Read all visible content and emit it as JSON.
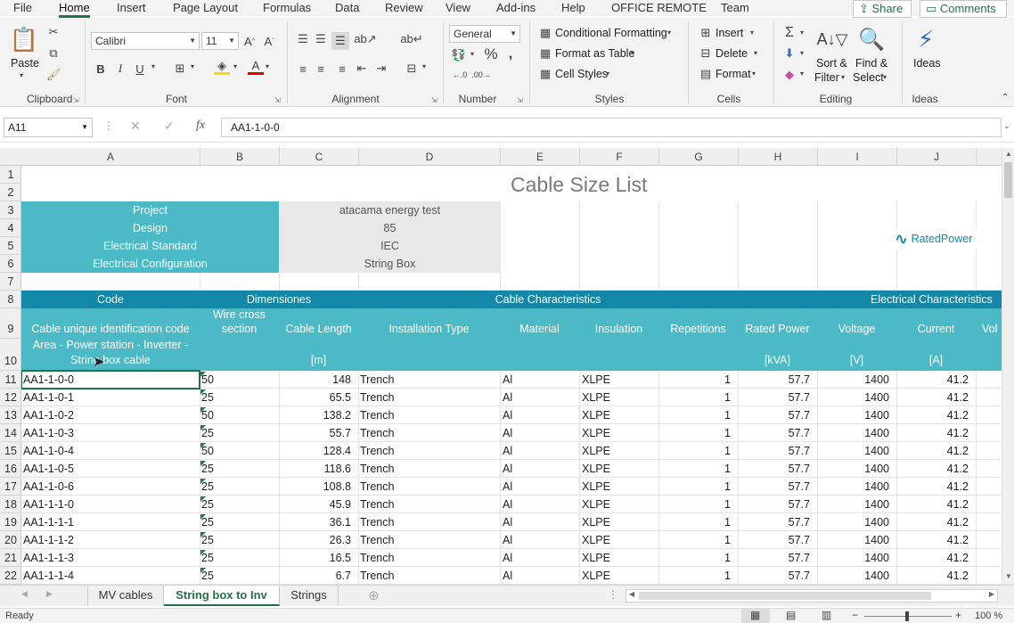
{
  "menu": {
    "tabs": [
      "File",
      "Home",
      "Insert",
      "Page Layout",
      "Formulas",
      "Data",
      "Review",
      "View",
      "Add-ins",
      "Help",
      "OFFICE REMOTE",
      "Team"
    ],
    "active": "Home",
    "share_label": "Share",
    "comments_label": "Comments"
  },
  "ribbon": {
    "clipboard": {
      "label": "Clipboard",
      "paste": "Paste"
    },
    "font": {
      "label": "Font",
      "name": "Calibri",
      "size": "11"
    },
    "alignment": {
      "label": "Alignment"
    },
    "number": {
      "label": "Number",
      "format": "General"
    },
    "styles": {
      "label": "Styles",
      "conditional": "Conditional Formatting",
      "format_table": "Format as Table",
      "cell_styles": "Cell Styles"
    },
    "cells": {
      "label": "Cells",
      "insert": "Insert",
      "delete": "Delete",
      "format": "Format"
    },
    "editing": {
      "label": "Editing",
      "sort1": "Sort &",
      "sort2": "Filter",
      "find1": "Find &",
      "find2": "Select"
    },
    "ideas": {
      "label": "Ideas",
      "button": "Ideas"
    }
  },
  "formula_bar": {
    "name_box": "A11",
    "fx": "fx",
    "value": "AA1-1-0-0"
  },
  "columns": [
    "A",
    "B",
    "C",
    "D",
    "E",
    "F",
    "G",
    "H",
    "I",
    "J"
  ],
  "rows": [
    "1",
    "2",
    "3",
    "4",
    "5",
    "6",
    "7",
    "8",
    "9",
    "10",
    "11",
    "12",
    "13",
    "14",
    "15",
    "16",
    "17",
    "18",
    "19",
    "20",
    "21",
    "22"
  ],
  "sheet": {
    "title": "Cable Size List",
    "logo_text": "RatedPower",
    "info": [
      {
        "label": "Project",
        "value": "atacama energy test"
      },
      {
        "label": "Design",
        "value": "85"
      },
      {
        "label": "Electrical Standard",
        "value": "IEC"
      },
      {
        "label": "Electrical Configuration",
        "value": "String Box"
      }
    ],
    "group_headers": {
      "code": "Code",
      "dimensiones": "Dimensiones",
      "cable": "Cable Characteristics",
      "electrical": "Electrical Characteristics"
    },
    "col_headers": {
      "a": "Cable unique identification code",
      "b1": "Wire cross",
      "b2": "section",
      "c": "Cable Length",
      "d": "Installation Type",
      "e": "Material",
      "f": "Insulation",
      "g": "Repetitions",
      "h": "Rated Power",
      "i": "Voltage",
      "j": "Current",
      "k": "Vol"
    },
    "units": {
      "a1": "Area - Power station - Inverter -",
      "a2": "String box cable",
      "c": "[m]",
      "h": "[kVA]",
      "i": "[V]",
      "j": "[A]"
    },
    "data": [
      [
        "AA1-1-0-0",
        "50",
        "148",
        "Trench",
        "Al",
        "XLPE",
        "1",
        "57.7",
        "1400",
        "41.2"
      ],
      [
        "AA1-1-0-1",
        "25",
        "65.5",
        "Trench",
        "Al",
        "XLPE",
        "1",
        "57.7",
        "1400",
        "41.2"
      ],
      [
        "AA1-1-0-2",
        "50",
        "138.2",
        "Trench",
        "Al",
        "XLPE",
        "1",
        "57.7",
        "1400",
        "41.2"
      ],
      [
        "AA1-1-0-3",
        "25",
        "55.7",
        "Trench",
        "Al",
        "XLPE",
        "1",
        "57.7",
        "1400",
        "41.2"
      ],
      [
        "AA1-1-0-4",
        "50",
        "128.4",
        "Trench",
        "Al",
        "XLPE",
        "1",
        "57.7",
        "1400",
        "41.2"
      ],
      [
        "AA1-1-0-5",
        "25",
        "118.6",
        "Trench",
        "Al",
        "XLPE",
        "1",
        "57.7",
        "1400",
        "41.2"
      ],
      [
        "AA1-1-0-6",
        "25",
        "108.8",
        "Trench",
        "Al",
        "XLPE",
        "1",
        "57.7",
        "1400",
        "41.2"
      ],
      [
        "AA1-1-1-0",
        "25",
        "45.9",
        "Trench",
        "Al",
        "XLPE",
        "1",
        "57.7",
        "1400",
        "41.2"
      ],
      [
        "AA1-1-1-1",
        "25",
        "36.1",
        "Trench",
        "Al",
        "XLPE",
        "1",
        "57.7",
        "1400",
        "41.2"
      ],
      [
        "AA1-1-1-2",
        "25",
        "26.3",
        "Trench",
        "Al",
        "XLPE",
        "1",
        "57.7",
        "1400",
        "41.2"
      ],
      [
        "AA1-1-1-3",
        "25",
        "16.5",
        "Trench",
        "Al",
        "XLPE",
        "1",
        "57.7",
        "1400",
        "41.2"
      ],
      [
        "AA1-1-1-4",
        "25",
        "6.7",
        "Trench",
        "Al",
        "XLPE",
        "1",
        "57.7",
        "1400",
        "41.2"
      ]
    ]
  },
  "sheet_tabs": [
    "MV cables",
    "String box to Inv",
    "Strings"
  ],
  "active_sheet": "String box to Inv",
  "status": {
    "ready": "Ready",
    "zoom": "100 %"
  },
  "colors": {
    "excel_green": "#217346",
    "teal": "#4bbac6",
    "dark_teal": "#1287a8"
  }
}
